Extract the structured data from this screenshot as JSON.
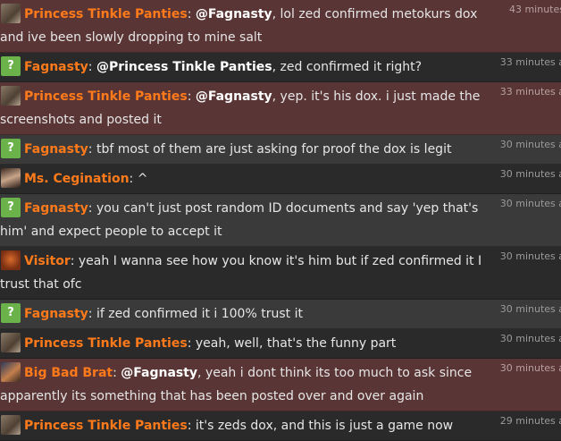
{
  "messages": [
    {
      "avatar": "photo-avatar",
      "name": "Princess Tinkle Panties",
      "mention": "@Fagnasty",
      "text": ", lol zed confirmed metokurs dox and ive been slowly dropping to mine salt",
      "time": "43 minutes",
      "style": "mention"
    },
    {
      "avatar": "question-avatar",
      "name": "Fagnasty",
      "mention": "@Princess Tinkle Panties",
      "text": ", zed confirmed it right?",
      "time": "33 minutes a",
      "style": "dark"
    },
    {
      "avatar": "photo-avatar",
      "name": "Princess Tinkle Panties",
      "mention": "@Fagnasty",
      "text": ", yep. it's his dox. i just made the screenshots and posted it",
      "time": "33 minutes a",
      "style": "mention"
    },
    {
      "avatar": "question-avatar",
      "name": "Fagnasty",
      "mention": "",
      "text": ": tbf most of them are just asking for proof the dox is legit",
      "time": "30 minutes a",
      "style": "alt"
    },
    {
      "avatar": "cegination-avatar",
      "name": "Ms. Cegination",
      "mention": "",
      "text": ": ^",
      "time": "30 minutes a",
      "style": "dark"
    },
    {
      "avatar": "question-avatar",
      "name": "Fagnasty",
      "mention": "",
      "text": ": you can't just post random ID documents and say 'yep that's him' and expect people to accept it",
      "time": "30 minutes a",
      "style": "alt"
    },
    {
      "avatar": "visitor-avatar",
      "name": "Visitor",
      "mention": "",
      "text": ": yeah I wanna see how you know it's him but if zed confirmed it I trust that ofc",
      "time": "30 minutes a",
      "style": "dark"
    },
    {
      "avatar": "question-avatar",
      "name": "Fagnasty",
      "mention": "",
      "text": ": if zed confirmed it i 100% trust it",
      "time": "30 minutes a",
      "style": "alt"
    },
    {
      "avatar": "photo-avatar",
      "name": "Princess Tinkle Panties",
      "mention": "",
      "text": ": yeah, well, that's the funny part",
      "time": "30 minutes a",
      "style": "dark"
    },
    {
      "avatar": "brat-avatar",
      "name": "Big Bad Brat",
      "mention": "@Fagnasty",
      "text": ", yeah i dont think its too much to ask since apparently its something that has been posted over and over again",
      "time": "30 minutes a",
      "style": "mention"
    },
    {
      "avatar": "photo-avatar",
      "name": "Princess Tinkle Panties",
      "mention": "",
      "text": ": it's zeds dox, and this is just a game now",
      "time": "29 minutes a",
      "style": "dark"
    }
  ],
  "question_mark": "?",
  "name_separator": ": "
}
